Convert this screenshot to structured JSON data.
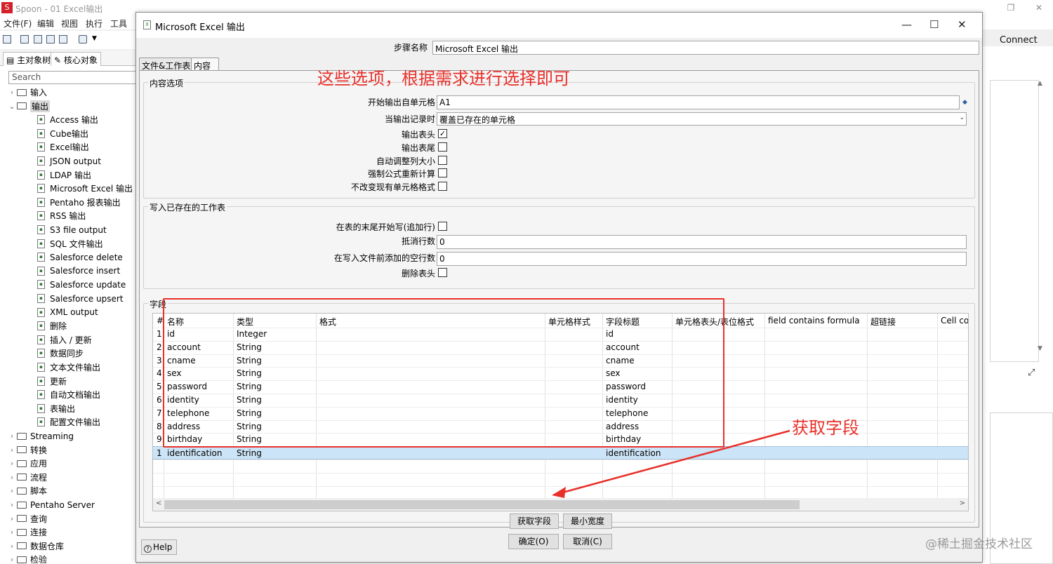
{
  "app": {
    "title": "Spoon - 01 Excel输出",
    "logo": "S",
    "menu": [
      "文件(F)",
      "编辑",
      "视图",
      "执行",
      "工具"
    ],
    "connect": "Connect"
  },
  "left_panel": {
    "tabs": [
      "主对象树",
      "核心对象"
    ],
    "search_placeholder": "Search",
    "tree": [
      {
        "label": "输入",
        "type": "folder",
        "expanded": false
      },
      {
        "label": "输出",
        "type": "folder",
        "expanded": true,
        "selected": true
      },
      {
        "label": "Access 输出",
        "type": "step"
      },
      {
        "label": "Cube输出",
        "type": "step"
      },
      {
        "label": "Excel输出",
        "type": "step"
      },
      {
        "label": "JSON output",
        "type": "step"
      },
      {
        "label": "LDAP 输出",
        "type": "step"
      },
      {
        "label": "Microsoft Excel 输出",
        "type": "step"
      },
      {
        "label": "Pentaho 报表输出",
        "type": "step"
      },
      {
        "label": "RSS 输出",
        "type": "step"
      },
      {
        "label": "S3 file output",
        "type": "step"
      },
      {
        "label": "SQL 文件输出",
        "type": "step"
      },
      {
        "label": "Salesforce delete",
        "type": "step"
      },
      {
        "label": "Salesforce insert",
        "type": "step"
      },
      {
        "label": "Salesforce update",
        "type": "step"
      },
      {
        "label": "Salesforce upsert",
        "type": "step"
      },
      {
        "label": "XML output",
        "type": "step"
      },
      {
        "label": "删除",
        "type": "step"
      },
      {
        "label": "插入 / 更新",
        "type": "step"
      },
      {
        "label": "数据同步",
        "type": "step"
      },
      {
        "label": "文本文件输出",
        "type": "step"
      },
      {
        "label": "更新",
        "type": "step"
      },
      {
        "label": "自动文档输出",
        "type": "step"
      },
      {
        "label": "表输出",
        "type": "step"
      },
      {
        "label": "配置文件输出",
        "type": "step"
      },
      {
        "label": "Streaming",
        "type": "folder",
        "expanded": false
      },
      {
        "label": "转换",
        "type": "folder",
        "expanded": false
      },
      {
        "label": "应用",
        "type": "folder",
        "expanded": false
      },
      {
        "label": "流程",
        "type": "folder",
        "expanded": false
      },
      {
        "label": "脚本",
        "type": "folder",
        "expanded": false
      },
      {
        "label": "Pentaho Server",
        "type": "folder",
        "expanded": false
      },
      {
        "label": "查询",
        "type": "folder",
        "expanded": false
      },
      {
        "label": "连接",
        "type": "folder",
        "expanded": false
      },
      {
        "label": "数据仓库",
        "type": "folder",
        "expanded": false
      },
      {
        "label": "检验",
        "type": "folder",
        "expanded": false
      }
    ]
  },
  "dialog": {
    "title": "Microsoft Excel 输出",
    "step_name_label": "步骤名称",
    "step_name_value": "Microsoft Excel 输出",
    "tabs": [
      "文件&工作表",
      "内容"
    ],
    "active_tab": "内容",
    "content_options": {
      "title": "内容选项",
      "start_cell_label": "开始输出自单元格",
      "start_cell_value": "A1",
      "when_output_label": "当输出记录时",
      "when_output_value": "覆盖已存在的单元格",
      "checkboxes": [
        {
          "label": "输出表头",
          "checked": true
        },
        {
          "label": "输出表尾",
          "checked": false
        },
        {
          "label": "自动调整列大小",
          "checked": false
        },
        {
          "label": "强制公式重新计算",
          "checked": false
        },
        {
          "label": "不改变现有单元格格式",
          "checked": false
        }
      ]
    },
    "write_existing": {
      "title": "写入已存在的工作表",
      "append_label": "在表的末尾开始写(追加行)",
      "append_checked": false,
      "offset_label": "抵消行数",
      "offset_value": "0",
      "blank_rows_label": "在写入文件前添加的空行数",
      "blank_rows_value": "0",
      "omit_header_label": "删除表头",
      "omit_header_checked": false
    },
    "fields": {
      "title": "字段",
      "columns": [
        "#",
        "名称",
        "类型",
        "格式",
        "单元格样式",
        "字段标题",
        "单元格表头/表位格式",
        "field contains formula",
        "超链接",
        "Cell co"
      ],
      "rows": [
        {
          "n": "1",
          "name": "id",
          "type": "Integer",
          "title": "id"
        },
        {
          "n": "2",
          "name": "account",
          "type": "String",
          "title": "account"
        },
        {
          "n": "3",
          "name": "cname",
          "type": "String",
          "title": "cname"
        },
        {
          "n": "4",
          "name": "sex",
          "type": "String",
          "title": "sex"
        },
        {
          "n": "5",
          "name": "password",
          "type": "String",
          "title": "password"
        },
        {
          "n": "6",
          "name": "identity",
          "type": "String",
          "title": "identity"
        },
        {
          "n": "7",
          "name": "telephone",
          "type": "String",
          "title": "telephone"
        },
        {
          "n": "8",
          "name": "address",
          "type": "String",
          "title": "address"
        },
        {
          "n": "9",
          "name": "birthday",
          "type": "String",
          "title": "birthday"
        },
        {
          "n": "1",
          "name": "identification",
          "type": "String",
          "title": "identification"
        }
      ],
      "get_fields_button": "获取字段",
      "min_width_button": "最小宽度"
    },
    "ok_button": "确定(O)",
    "cancel_button": "取消(C)",
    "help_button": "Help"
  },
  "annotations": {
    "top_note": "这些选项，根据需求进行选择即可",
    "get_fields_note": "获取字段",
    "color": "#e8302a"
  },
  "watermark": "@稀土掘金技术社区"
}
